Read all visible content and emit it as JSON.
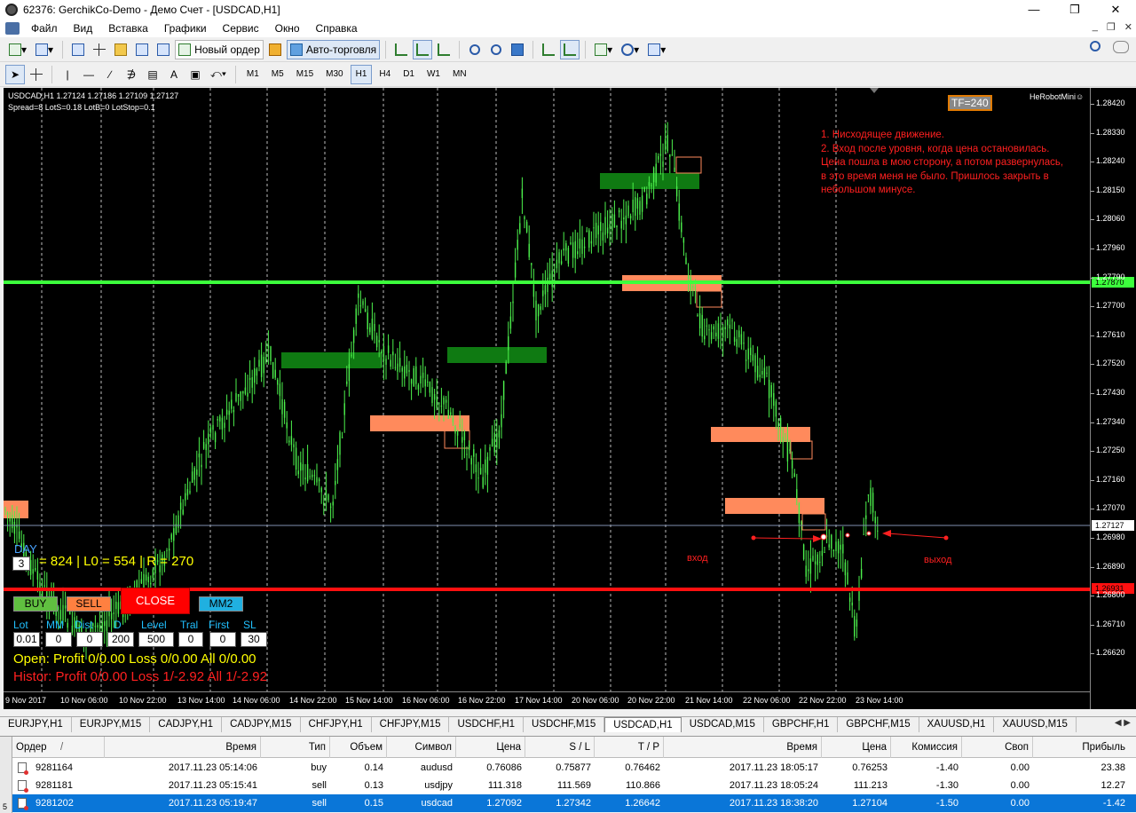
{
  "window": {
    "title": "62376: GerchikCo-Demo - Демо Счет - [USDCAD,H1]"
  },
  "menu": [
    "Файл",
    "Вид",
    "Вставка",
    "Графики",
    "Сервис",
    "Окно",
    "Справка"
  ],
  "toolbar": {
    "new_order": "Новый ордер",
    "autotrading": "Авто-торговля"
  },
  "timeframes": [
    "M1",
    "M5",
    "M15",
    "M30",
    "H1",
    "H4",
    "D1",
    "W1",
    "MN"
  ],
  "chart": {
    "symbol_line": "USDCAD,H1  1.27124 1.27186 1.27109 1.27127",
    "spread_line": "Spread=8  LotS=0.18  LotB=0  LotStop=0.1",
    "tf_box": "TF=240",
    "robot": "HeRobotMini☺",
    "note": [
      "1. Нисходящее движение.",
      "2. Вход после уровня, когда цена остановилась.",
      "Цена пошла в мою сторону, а потом развернулась,",
      "в это время меня не было. Пришлось закрыть в",
      "небольшом минусе."
    ],
    "entry_label": "вход",
    "exit_label": "выход",
    "price_labels": [
      "1.28420",
      "1.28330",
      "1.28240",
      "1.28150",
      "1.28060",
      "1.27960",
      "1.27790",
      "1.27700",
      "1.27610",
      "1.27520",
      "1.27430",
      "1.27340",
      "1.27250",
      "1.27160",
      "1.27070",
      "1.26980",
      "1.26890",
      "1.26800",
      "1.26710",
      "1.26620"
    ],
    "green_level": "1.27870",
    "current_price": "1.27127",
    "red_level": "1.26931",
    "time_labels": [
      "9 Nov 2017",
      "10 Nov 06:00",
      "10 Nov 22:00",
      "13 Nov 14:00",
      "14 Nov 06:00",
      "14 Nov 22:00",
      "15 Nov 14:00",
      "16 Nov 06:00",
      "16 Nov 22:00",
      "17 Nov 14:00",
      "20 Nov 06:00",
      "20 Nov 22:00",
      "21 Nov 14:00",
      "22 Nov 06:00",
      "22 Nov 22:00",
      "23 Nov 14:00"
    ]
  },
  "panel": {
    "day_label": "DAY",
    "day_value": "3",
    "stats": "= 824 | L0 = 554 | R = 270",
    "buy": "BUY",
    "sell": "SELL",
    "close": "CLOSE",
    "mm2": "MM2",
    "labels": [
      "Lot",
      "MM",
      "Dist",
      "D",
      "Level",
      "Tral",
      "First",
      "SL"
    ],
    "inputs": [
      "0.01",
      "0",
      "0",
      "200",
      "500",
      "0",
      "0",
      "30"
    ],
    "open_line": "Open:  Profit 0/0.00  Loss 0/0.00  All 0/0.00",
    "history_line": "Histor:  Profit 0/0.00  Loss 1/-2.92  All 1/-2.92"
  },
  "chart_tabs": [
    "EURJPY,H1",
    "EURJPY,M15",
    "CADJPY,H1",
    "CADJPY,M15",
    "CHFJPY,H1",
    "CHFJPY,M15",
    "USDCHF,H1",
    "USDCHF,M15",
    "USDCAD,H1",
    "USDCAD,M15",
    "GBPCHF,H1",
    "GBPCHF,M15",
    "XAUUSD,H1",
    "XAUUSD,M15"
  ],
  "active_tab": "USDCAD,H1",
  "terminal": {
    "side_label": "5",
    "headers": [
      "Ордер",
      "/",
      "Время",
      "Тип",
      "Объем",
      "Символ",
      "Цена",
      "S / L",
      "T / P",
      "Время",
      "Цена",
      "Комиссия",
      "Своп",
      "Прибыль"
    ],
    "rows": [
      [
        "9281164",
        "2017.11.23 05:14:06",
        "buy",
        "0.14",
        "audusd",
        "0.76086",
        "0.75877",
        "0.76462",
        "2017.11.23 18:05:17",
        "0.76253",
        "-1.40",
        "0.00",
        "23.38"
      ],
      [
        "9281181",
        "2017.11.23 05:15:41",
        "sell",
        "0.13",
        "usdjpy",
        "111.318",
        "111.569",
        "110.866",
        "2017.11.23 18:05:24",
        "111.213",
        "-1.30",
        "0.00",
        "12.27"
      ],
      [
        "9281202",
        "2017.11.23 05:19:47",
        "sell",
        "0.15",
        "usdcad",
        "1.27092",
        "1.27342",
        "1.26642",
        "2017.11.23 18:38:20",
        "1.27104",
        "-1.50",
        "0.00",
        "-1.42"
      ]
    ]
  }
}
